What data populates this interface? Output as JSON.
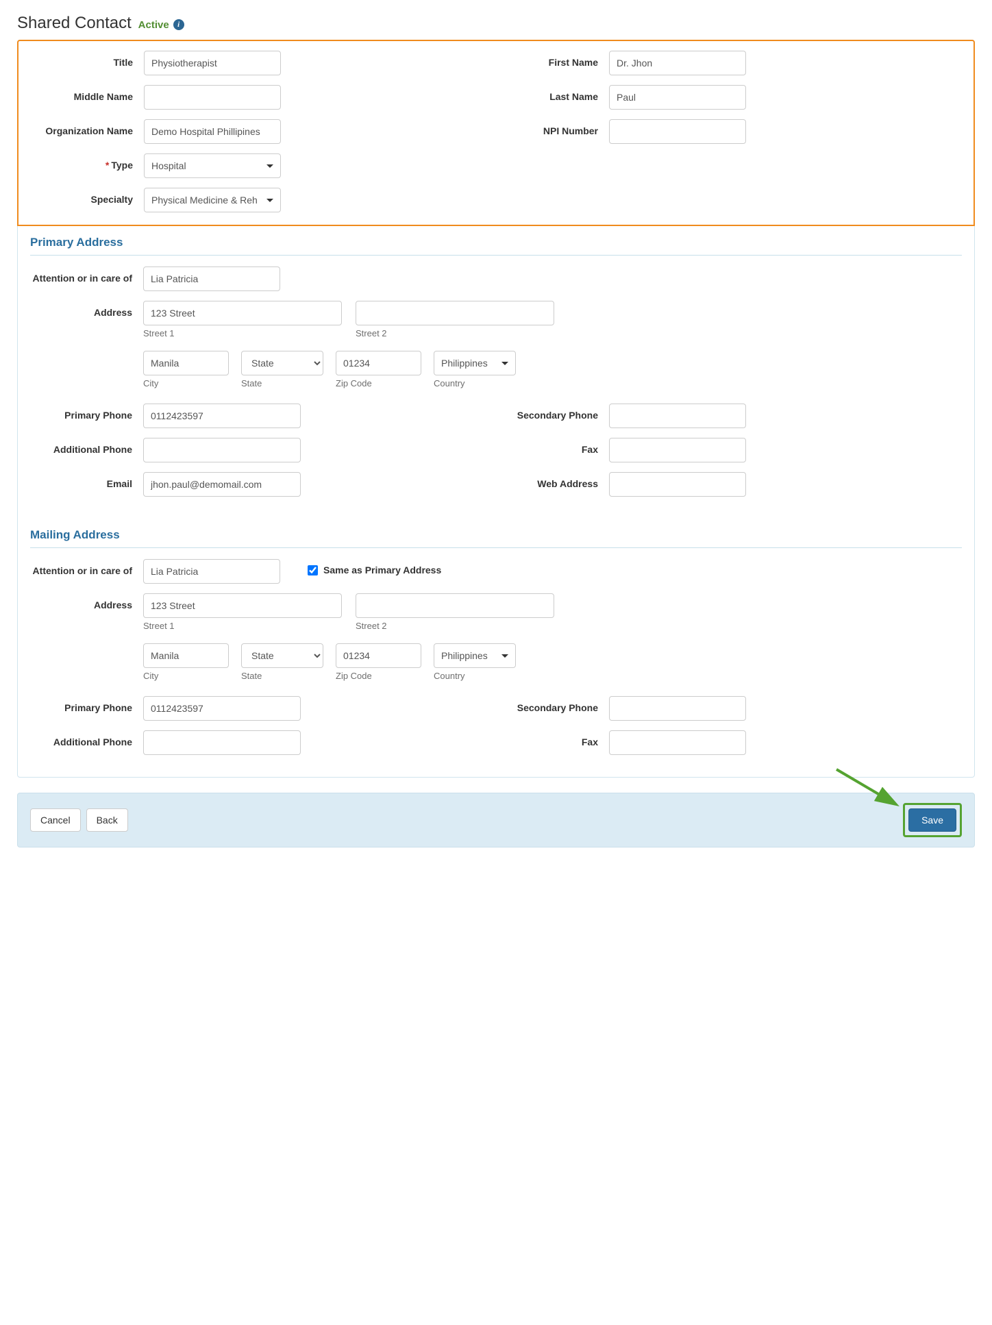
{
  "header": {
    "title": "Shared Contact",
    "status": "Active"
  },
  "labels": {
    "title": "Title",
    "firstName": "First Name",
    "middleName": "Middle Name",
    "lastName": "Last Name",
    "orgName": "Organization Name",
    "npiNumber": "NPI Number",
    "type": "Type",
    "specialty": "Specialty",
    "primaryAddress": "Primary Address",
    "mailingAddress": "Mailing Address",
    "attention": "Attention or in care of",
    "address": "Address",
    "street1": "Street 1",
    "street2": "Street 2",
    "city": "City",
    "state": "State",
    "zip": "Zip Code",
    "country": "Country",
    "primaryPhone": "Primary Phone",
    "secondaryPhone": "Secondary Phone",
    "additionalPhone": "Additional Phone",
    "fax": "Fax",
    "email": "Email",
    "webAddress": "Web Address",
    "sameAsPrimary": "Same as Primary Address"
  },
  "values": {
    "title": "Physiotherapist",
    "firstName": "Dr. Jhon",
    "middleName": "",
    "lastName": "Paul",
    "orgName": "Demo Hospital Phillipines",
    "npiNumber": "",
    "type": "Hospital",
    "specialty": "Physical Medicine & Rehab",
    "primary": {
      "attention": "Lia Patricia",
      "street1": "123 Street",
      "street2": "",
      "city": "Manila",
      "state": "State",
      "zip": "01234",
      "country": "Philippines",
      "primaryPhone": "0112423597",
      "secondaryPhone": "",
      "additionalPhone": "",
      "fax": "",
      "email": "jhon.paul@demomail.com",
      "webAddress": ""
    },
    "mailing": {
      "sameAsPrimary": true,
      "attention": "Lia Patricia",
      "street1": "123 Street",
      "street2": "",
      "city": "Manila",
      "state": "State",
      "zip": "01234",
      "country": "Philippines",
      "primaryPhone": "0112423597",
      "secondaryPhone": "",
      "additionalPhone": "",
      "fax": ""
    }
  },
  "buttons": {
    "cancel": "Cancel",
    "back": "Back",
    "save": "Save"
  }
}
